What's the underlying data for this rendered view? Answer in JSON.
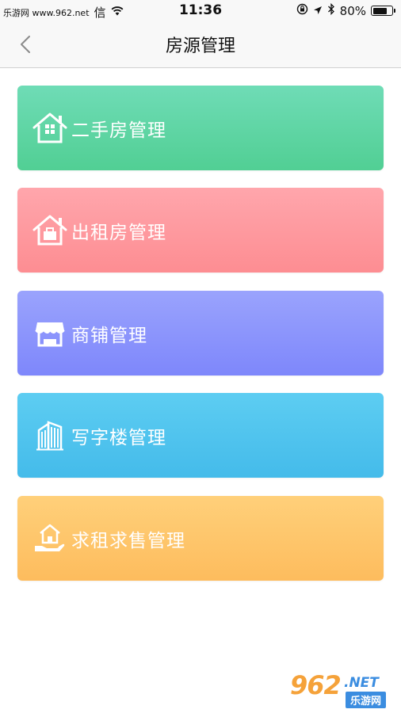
{
  "status_bar": {
    "site": "乐游网 www.962.net",
    "carrier": "信",
    "time": "11:36",
    "battery_text": "80%",
    "battery_level": 0.8
  },
  "nav": {
    "title": "房源管理"
  },
  "cards": [
    {
      "label": "二手房管理",
      "icon": "house-icon",
      "color": "#5dd5a4"
    },
    {
      "label": "出租房管理",
      "icon": "rent-house-icon",
      "color": "#fe9aa0"
    },
    {
      "label": "商铺管理",
      "icon": "shop-icon",
      "color": "#8c95fc"
    },
    {
      "label": "写字楼管理",
      "icon": "office-building-icon",
      "color": "#51c4ee"
    },
    {
      "label": "求租求售管理",
      "icon": "hand-house-icon",
      "color": "#fec66b"
    }
  ],
  "watermark": {
    "number": "962",
    "suffix": ".NET",
    "name": "乐游网"
  }
}
